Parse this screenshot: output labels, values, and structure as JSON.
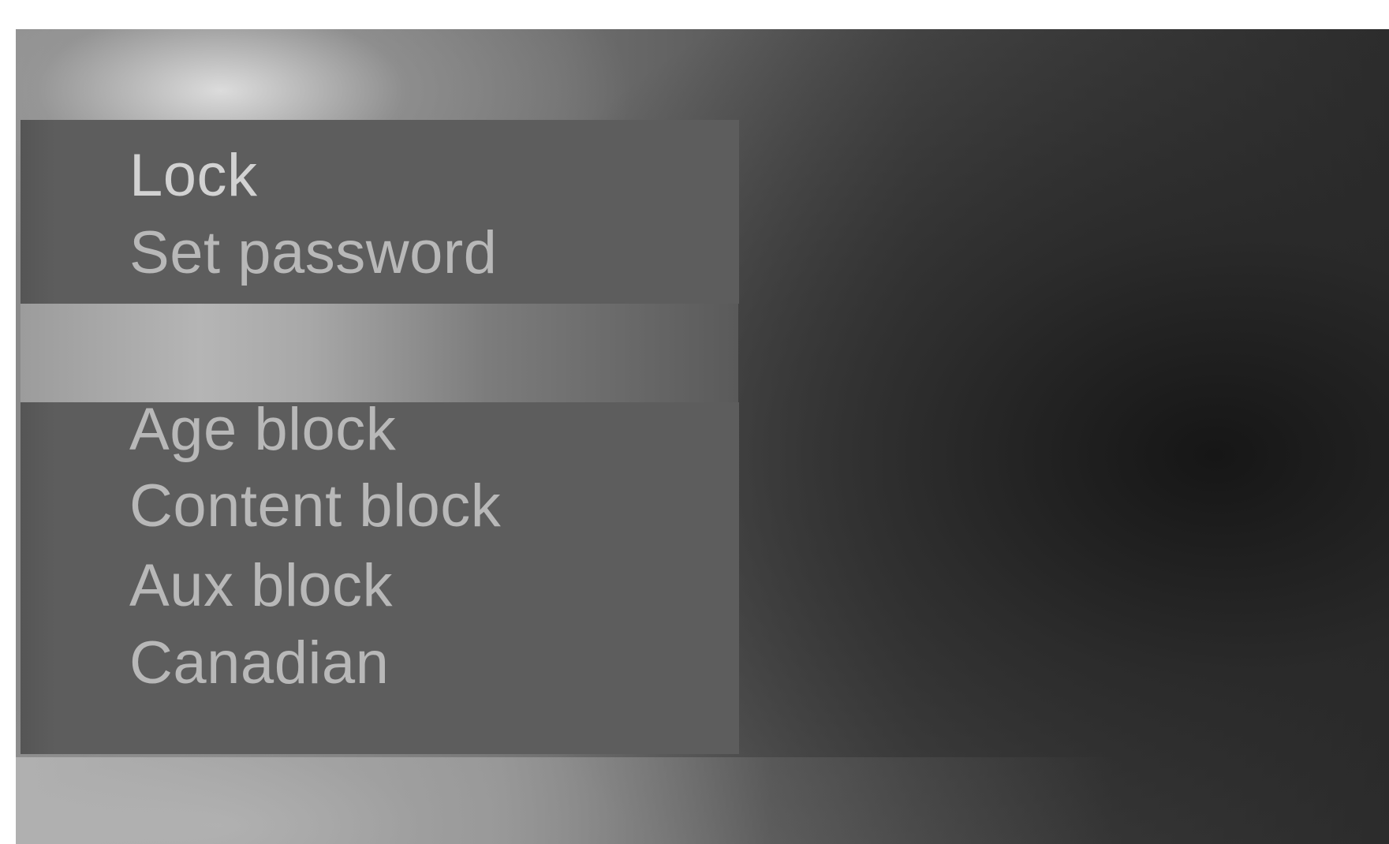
{
  "osd_menu": {
    "primary_items": [
      {
        "label": "Lock"
      },
      {
        "label": "Set password"
      }
    ],
    "secondary_items": [
      {
        "label": "Age block"
      },
      {
        "label": "Content block"
      },
      {
        "label": "Aux block"
      },
      {
        "label": "Canadian"
      }
    ],
    "selected_item": "Lock"
  }
}
